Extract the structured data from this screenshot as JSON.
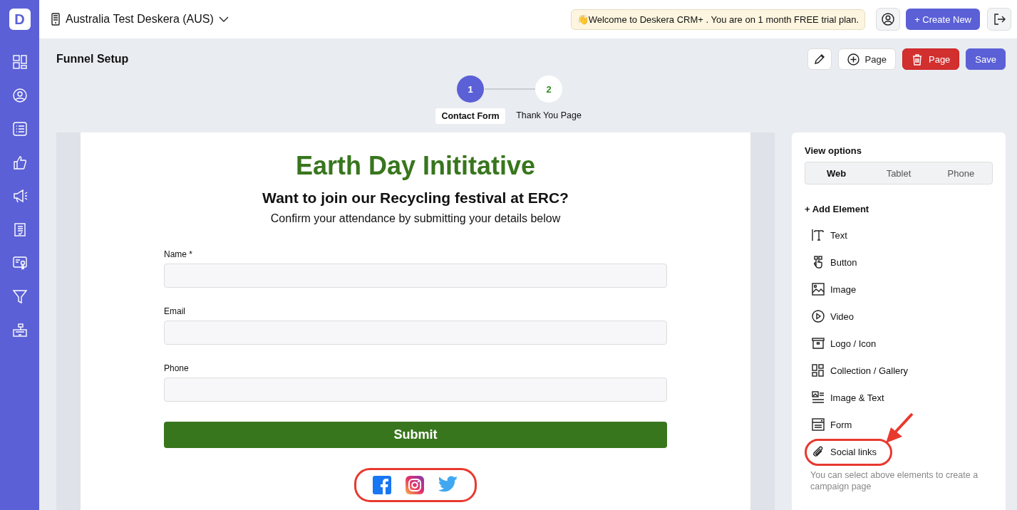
{
  "logo": "D",
  "workspace": {
    "name": "Australia Test Deskera (AUS)"
  },
  "banner": "👋Welcome to Deskera CRM+ . You are on 1 month FREE trial plan.",
  "create_button": "+ Create New",
  "page_title": "Funnel Setup",
  "toolbar": [
    {
      "kind": "edit"
    },
    {
      "kind": "add",
      "label": "Page"
    },
    {
      "kind": "delete",
      "label": "Page"
    },
    {
      "kind": "save",
      "label": "Save"
    }
  ],
  "steps": [
    {
      "number": "1",
      "label": "Contact Form",
      "selected": true
    },
    {
      "number": "2",
      "label": "Thank You Page",
      "selected": false
    }
  ],
  "form_page": {
    "title": "Earth Day Inititative",
    "heading": "Want to join our Recycling festival at ERC?",
    "subheading": "Confirm your attendance by submitting your details below",
    "fields": [
      {
        "label": "Name *"
      },
      {
        "label": "Email"
      },
      {
        "label": "Phone"
      }
    ],
    "submit": "Submit"
  },
  "view_options": {
    "title": "View options",
    "tabs": [
      {
        "label": "Web",
        "selected": true
      },
      {
        "label": "Tablet",
        "selected": false
      },
      {
        "label": "Phone",
        "selected": false
      }
    ]
  },
  "add_element": {
    "title": "+ Add Element",
    "items": [
      {
        "kind": "text",
        "label": "Text"
      },
      {
        "kind": "button",
        "label": "Button"
      },
      {
        "kind": "image",
        "label": "Image"
      },
      {
        "kind": "video",
        "label": "Video"
      },
      {
        "kind": "logo",
        "label": "Logo / Icon"
      },
      {
        "kind": "gallery",
        "label": "Collection / Gallery"
      },
      {
        "kind": "imagetext",
        "label": "Image & Text"
      },
      {
        "kind": "form",
        "label": "Form"
      },
      {
        "kind": "social",
        "label": "Social links"
      }
    ],
    "hint": "You can select above elements to create a campaign page"
  }
}
